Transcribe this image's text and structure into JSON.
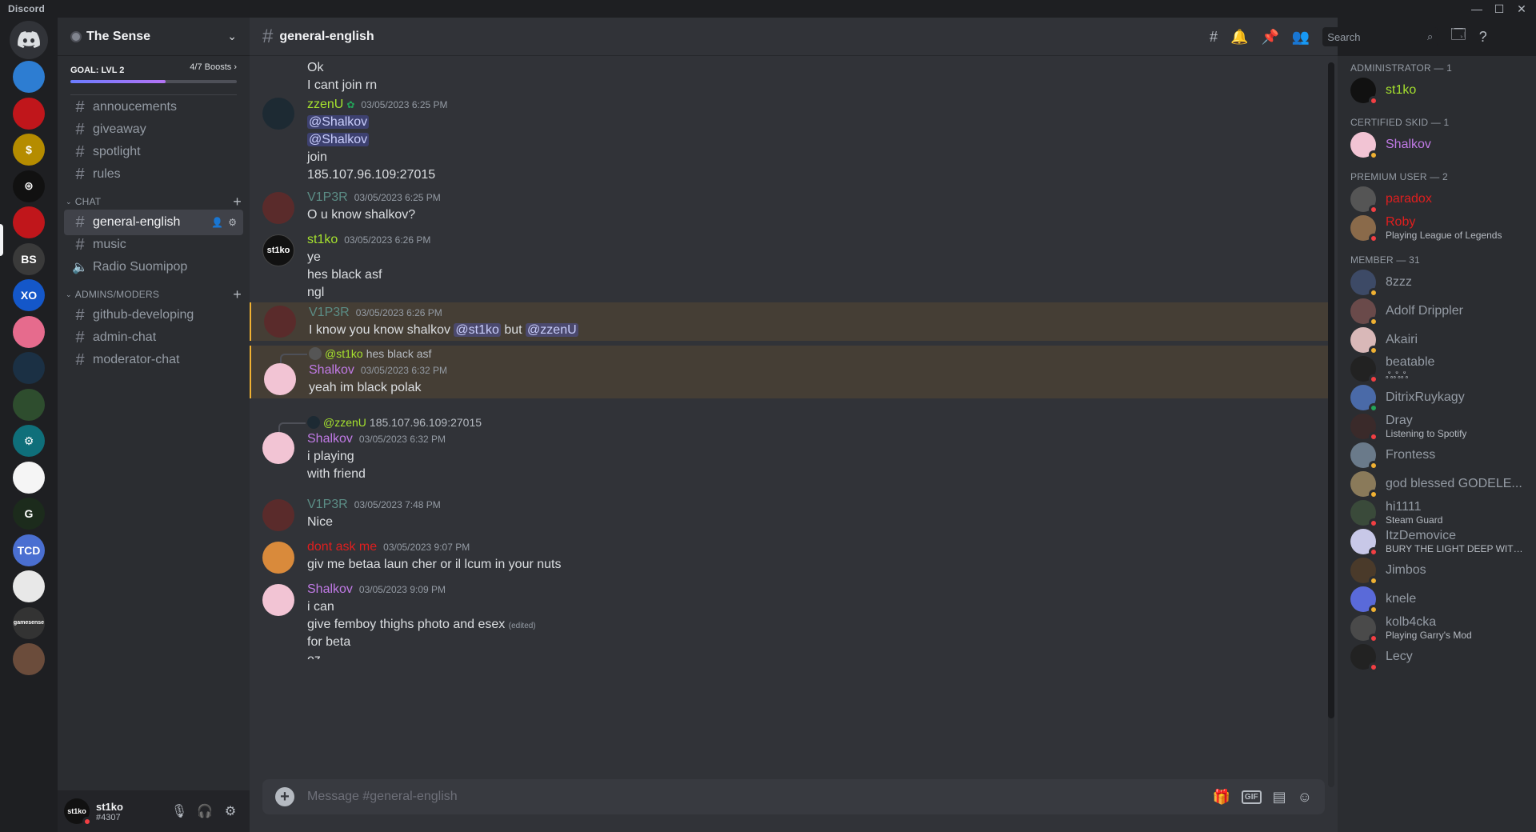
{
  "window": {
    "app_title": "Discord",
    "controls": [
      "—",
      "☐",
      "✕"
    ]
  },
  "servers": [
    {
      "name": "home",
      "color": "#313338",
      "glyph": "discord"
    },
    {
      "name": "server-1",
      "color": "#2d7dd2",
      "glyph": ""
    },
    {
      "name": "server-2",
      "color": "#c0161b",
      "glyph": ""
    },
    {
      "name": "server-3",
      "color": "#b58c00",
      "glyph": "$"
    },
    {
      "name": "server-4",
      "color": "#111111",
      "glyph": "⊛"
    },
    {
      "name": "server-5",
      "color": "#c0161b",
      "glyph": ""
    },
    {
      "name": "server-6",
      "color": "#3a3a3a",
      "glyph": "BS"
    },
    {
      "name": "server-7",
      "color": "#1457c9",
      "glyph": "XO"
    },
    {
      "name": "server-8",
      "color": "#e66b8d",
      "glyph": ""
    },
    {
      "name": "server-9",
      "color": "#1b3044",
      "glyph": ""
    },
    {
      "name": "server-10",
      "color": "#2e4d2e",
      "glyph": ""
    },
    {
      "name": "server-11",
      "color": "#0f6f7a",
      "glyph": "⚙"
    },
    {
      "name": "server-12",
      "color": "#f5f5f5",
      "glyph": ""
    },
    {
      "name": "server-13",
      "color": "#1c2b1c",
      "glyph": "G"
    },
    {
      "name": "server-14",
      "color": "#4a6fd1",
      "glyph": "TCD"
    },
    {
      "name": "server-15",
      "color": "#e8e8e8",
      "glyph": ""
    },
    {
      "name": "server-16",
      "color": "#333333",
      "glyph": "gamesense"
    },
    {
      "name": "server-17",
      "color": "#6b4c3b",
      "glyph": ""
    }
  ],
  "guild": {
    "name": "The Sense",
    "boost_goal": "GOAL: LVL 2",
    "boost_count": "4/7 Boosts",
    "boost_progress": 0.57
  },
  "channels_top": [
    "annoucements",
    "giveaway",
    "spotlight",
    "rules"
  ],
  "category_chat": "CHAT",
  "channels_chat": [
    {
      "name": "general-english",
      "active": true,
      "type": "text"
    },
    {
      "name": "music",
      "active": false,
      "type": "text"
    },
    {
      "name": "Radio Suomipop",
      "active": false,
      "type": "voice"
    }
  ],
  "category_admins": "ADMINS/MODERS",
  "channels_admins": [
    "github-developing",
    "admin-chat",
    "moderator-chat"
  ],
  "user": {
    "name": "st1ko",
    "tag": "#4307",
    "avatar_text": "st1ko"
  },
  "header": {
    "channel": "general-english",
    "search_placeholder": "Search"
  },
  "composer": {
    "placeholder": "Message #general-english",
    "gif": "GIF"
  },
  "messages": {
    "m0": {
      "lines": [
        "Ok",
        "I cant join rn"
      ]
    },
    "m1": {
      "author": "zzenU",
      "color": "#a6e22e",
      "ts": "03/05/2023 6:25 PM",
      "l1": "@Shalkov",
      "l2": "@Shalkov",
      "l3": "join",
      "l4": "185.107.96.109:27015"
    },
    "m2": {
      "author": "V1P3R",
      "color": "#5b8c85",
      "ts": "03/05/2023 6:25 PM",
      "l1": "O u know shalkov?"
    },
    "m3": {
      "author": "st1ko",
      "color": "#a6e22e",
      "ts": "03/05/2023 6:26 PM",
      "avatar_text": "st1ko",
      "l1": "ye",
      "l2": "hes black asf",
      "l3": "ngl"
    },
    "m4": {
      "author": "V1P3R",
      "color": "#5b8c85",
      "ts": "03/05/2023 6:26 PM",
      "pre": "I know you know shalkov ",
      "mention1": "@st1ko",
      "mid": " but ",
      "mention2": "@zzenU"
    },
    "m5": {
      "reply_user": "@st1ko",
      "reply_text": "hes black asf",
      "author": "Shalkov",
      "color": "#c17ae6",
      "ts": "03/05/2023 6:32 PM",
      "l1": "yeah im black polak"
    },
    "m6": {
      "reply_user": "@zzenU",
      "reply_text": "185.107.96.109:27015",
      "author": "Shalkov",
      "color": "#c17ae6",
      "ts": "03/05/2023 6:32 PM",
      "l1": "i playing",
      "l2": "with friend"
    },
    "m7": {
      "author": "V1P3R",
      "color": "#5b8c85",
      "ts": "03/05/2023 7:48 PM",
      "l1": "Nice"
    },
    "m8": {
      "author": "dont ask me",
      "color": "#e01e1e",
      "ts": "03/05/2023 9:07 PM",
      "l1": "giv me betaa laun cher or il lcum in your nuts"
    },
    "m9": {
      "author": "Shalkov",
      "color": "#c17ae6",
      "ts": "03/05/2023 9:09 PM",
      "l1": "i can",
      "l2": "give femboy thighs photo and esex",
      "edited": "(edited)",
      "l3": "for beta",
      "l4": "ez"
    }
  },
  "members": {
    "r1": "ADMINISTRATOR — 1",
    "r2": "CERTIFIED SKID — 1",
    "r3": "PREMIUM USER — 2",
    "r4": "MEMBER — 31",
    "list": [
      {
        "name": "st1ko",
        "color": "#a6e22e",
        "status": "",
        "st": "dnd"
      },
      {
        "name": "Shalkov",
        "color": "#c17ae6",
        "status": "",
        "st": "idle"
      },
      {
        "name": "paradox",
        "color": "#e01e1e",
        "status": "",
        "st": "dnd"
      },
      {
        "name": "Roby",
        "color": "#e01e1e",
        "status": "Playing League of Legends",
        "st": "dnd"
      },
      {
        "name": "8zzz",
        "color": "#949ba4",
        "status": "",
        "st": "idle"
      },
      {
        "name": "Adolf Drippler",
        "color": "#949ba4",
        "status": "",
        "st": "idle"
      },
      {
        "name": "Akairi",
        "color": "#949ba4",
        "status": "",
        "st": "idle"
      },
      {
        "name": "beatable",
        "color": "#949ba4",
        "status": "ஃஃஃ",
        "st": "dnd"
      },
      {
        "name": "DitrixRuykagy",
        "color": "#949ba4",
        "status": "",
        "st": "online"
      },
      {
        "name": "Dray",
        "color": "#949ba4",
        "status": "Listening to Spotify",
        "st": "dnd"
      },
      {
        "name": "Frontess",
        "color": "#949ba4",
        "status": "",
        "st": "idle"
      },
      {
        "name": "god blessed GODELE...",
        "color": "#949ba4",
        "status": "",
        "st": "idle"
      },
      {
        "name": "hi1111",
        "color": "#949ba4",
        "status": "Steam Guard",
        "st": "dnd"
      },
      {
        "name": "ItzDemovice",
        "color": "#949ba4",
        "status": "BURY THE LIGHT DEEP WITH...",
        "st": "dnd"
      },
      {
        "name": "Jimbos",
        "color": "#949ba4",
        "status": "",
        "st": "idle"
      },
      {
        "name": "knele",
        "color": "#949ba4",
        "status": "",
        "st": "idle"
      },
      {
        "name": "kolb4cka",
        "color": "#949ba4",
        "status": "Playing Garry's Mod",
        "st": "dnd"
      },
      {
        "name": "Lecy",
        "color": "#949ba4",
        "status": "",
        "st": "dnd"
      }
    ]
  }
}
